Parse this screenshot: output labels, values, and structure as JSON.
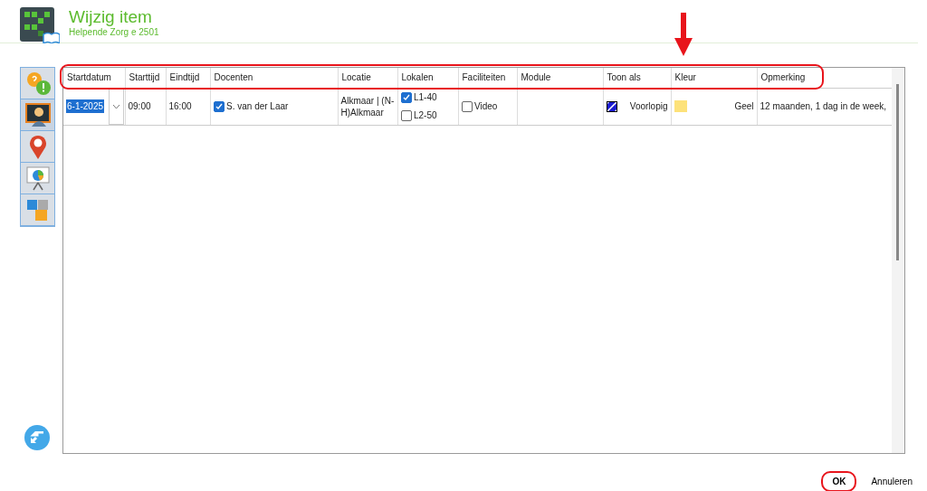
{
  "header": {
    "title": "Wijzig item",
    "subtitle": "Helpende Zorg e 2501"
  },
  "sidebar": {
    "items": [
      {
        "selected": false
      },
      {
        "selected": true
      },
      {
        "selected": false
      },
      {
        "selected": false
      },
      {
        "selected": false
      }
    ]
  },
  "table": {
    "highlighted": true,
    "columns": [
      "Startdatum",
      "Starttijd",
      "Eindtijd",
      "Docenten",
      "Locatie",
      "Lokalen",
      "Faciliteiten",
      "Module",
      "Toon als",
      "Kleur",
      "Opmerking"
    ],
    "rows": [
      {
        "startdatum": "6-1-2025",
        "starttijd": "09:00",
        "eindtijd": "16:00",
        "docenten": [
          {
            "label": "S. van der Laar",
            "checked": true
          }
        ],
        "locatie": "Alkmaar | (N-H)Alkmaar",
        "lokalen": [
          {
            "label": "L1-40",
            "checked": true
          },
          {
            "label": "L2-50",
            "checked": false
          }
        ],
        "faciliteiten": [
          {
            "label": "Video",
            "checked": false
          }
        ],
        "toon_als": "Voorlopig",
        "kleur": {
          "label": "Geel",
          "color": "#fde27a"
        },
        "opmerking": "12 maanden, 1 dag in de week,"
      }
    ]
  },
  "buttons": [
    {
      "label": "OK",
      "kind": "primary",
      "highlighted": true
    },
    {
      "label": "Annuleren",
      "kind": "secondary",
      "highlighted": false
    }
  ]
}
